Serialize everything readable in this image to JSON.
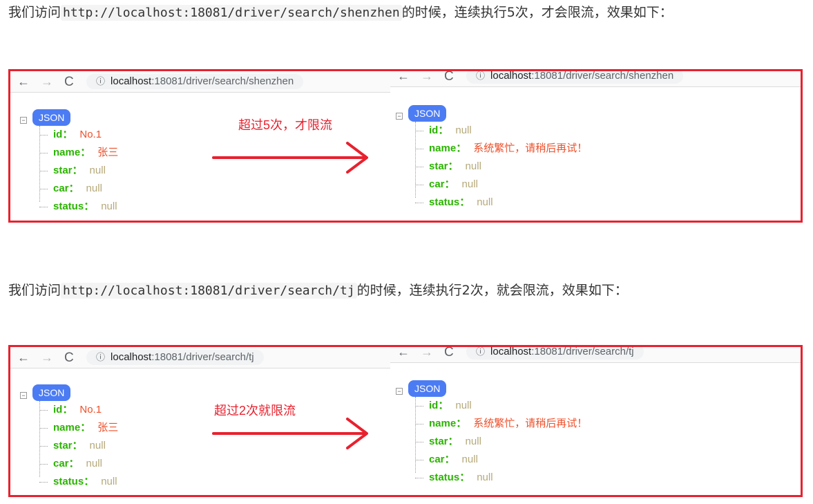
{
  "sections": [
    {
      "text_before": "我们访问",
      "url_code": "http://localhost:18081/driver/search/shenzhen",
      "text_after": "的时候，连续执行5次，才会限流，效果如下：",
      "arrow_label": "超过5次，才限流",
      "left": {
        "host": "localhost",
        "path": ":18081/driver/search/shenzhen",
        "json_label": "JSON",
        "rows": [
          {
            "key": "id",
            "value": "No.1",
            "is_null": false
          },
          {
            "key": "name",
            "value": "张三",
            "is_null": false
          },
          {
            "key": "star",
            "value": "null",
            "is_null": true
          },
          {
            "key": "car",
            "value": "null",
            "is_null": true
          },
          {
            "key": "status",
            "value": "null",
            "is_null": true
          }
        ]
      },
      "right": {
        "host": "localhost",
        "path": ":18081/driver/search/shenzhen",
        "json_label": "JSON",
        "rows": [
          {
            "key": "id",
            "value": "null",
            "is_null": true
          },
          {
            "key": "name",
            "value": "系统繁忙，请稍后再试！",
            "is_null": false
          },
          {
            "key": "star",
            "value": "null",
            "is_null": true
          },
          {
            "key": "car",
            "value": "null",
            "is_null": true
          },
          {
            "key": "status",
            "value": "null",
            "is_null": true
          }
        ]
      }
    },
    {
      "text_before": "我们访问",
      "url_code": "http://localhost:18081/driver/search/tj",
      "text_after": "的时候，连续执行2次，就会限流，效果如下：",
      "arrow_label": "超过2次就限流",
      "left": {
        "host": "localhost",
        "path": ":18081/driver/search/tj",
        "json_label": "JSON",
        "rows": [
          {
            "key": "id",
            "value": "No.1",
            "is_null": false
          },
          {
            "key": "name",
            "value": "张三",
            "is_null": false
          },
          {
            "key": "star",
            "value": "null",
            "is_null": true
          },
          {
            "key": "car",
            "value": "null",
            "is_null": true
          },
          {
            "key": "status",
            "value": "null",
            "is_null": true
          }
        ]
      },
      "right": {
        "host": "localhost",
        "path": ":18081/driver/search/tj",
        "json_label": "JSON",
        "rows": [
          {
            "key": "id",
            "value": "null",
            "is_null": true
          },
          {
            "key": "name",
            "value": "系统繁忙，请稍后再试！",
            "is_null": false
          },
          {
            "key": "star",
            "value": "null",
            "is_null": true
          },
          {
            "key": "car",
            "value": "null",
            "is_null": true
          },
          {
            "key": "status",
            "value": "null",
            "is_null": true
          }
        ]
      }
    }
  ],
  "icons": {
    "back": "←",
    "forward": "→",
    "reload": "C",
    "info": "ⓘ",
    "toggle": "−"
  },
  "colors": {
    "frame": "#e8212e",
    "json_badge": "#4c7cf4",
    "key": "#2bb300",
    "value": "#ee4f2a",
    "null": "#b5a97a"
  }
}
